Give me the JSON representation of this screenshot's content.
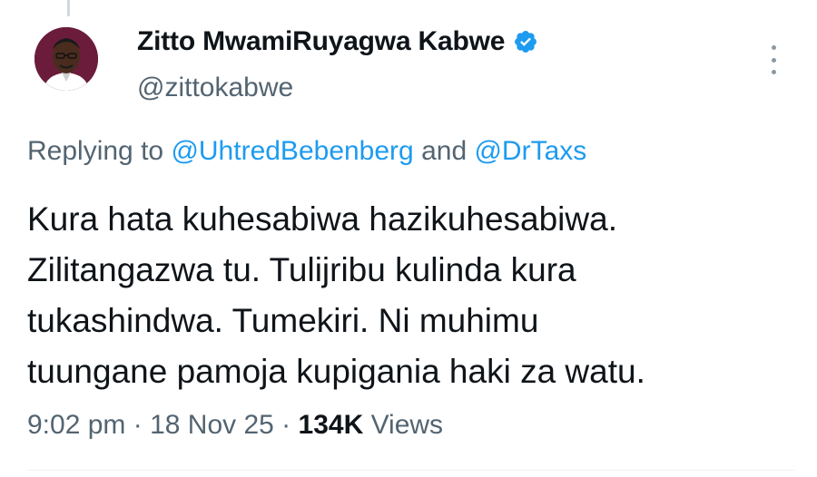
{
  "author": {
    "display_name": "Zitto MwamiRuyagwa Kabwe",
    "handle": "@zittokabwe",
    "verified": true
  },
  "reply": {
    "prefix": "Replying to ",
    "mention_1": "@UhtredBebenberg",
    "connector": " and ",
    "mention_2": "@DrTaxs"
  },
  "tweet": {
    "lines": [
      "Kura hata kuhesabiwa hazikuhesabiwa.",
      "Zilitangazwa tu. Tulijribu kulinda kura",
      "tukashindwa. Tumekiri. Ni muhimu",
      "tuungane pamoja kupigania haki za watu."
    ]
  },
  "meta": {
    "time": "9:02 pm",
    "separator_1": " · ",
    "date": "18 Nov 25",
    "separator_2": " · ",
    "views_count": "134K",
    "views_label": " Views"
  },
  "icons": {
    "verified": "verified-badge-icon",
    "more": "more-options-icon"
  },
  "colors": {
    "link": "#1d9bf0",
    "secondary_text": "#536471",
    "primary_text": "#0f1419",
    "verified": "#1d9bf0"
  }
}
